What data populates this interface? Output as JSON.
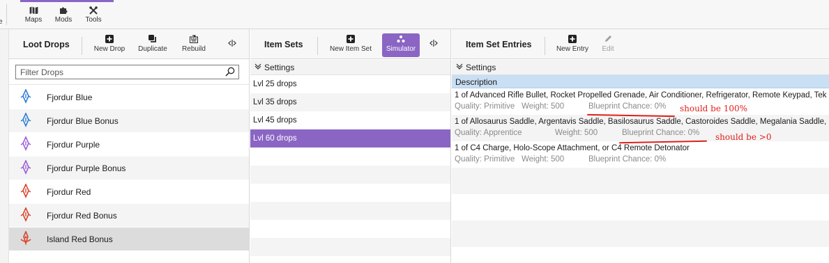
{
  "topbar": {
    "edge_label": "e",
    "buttons": [
      {
        "label": "Maps",
        "icon": "map-icon"
      },
      {
        "label": "Mods",
        "icon": "puzzle-icon"
      },
      {
        "label": "Tools",
        "icon": "tools-icon"
      }
    ]
  },
  "loot_drops": {
    "title": "Loot Drops",
    "buttons": {
      "new_drop": "New Drop",
      "duplicate": "Duplicate",
      "rebuild": "Rebuild"
    },
    "filter_placeholder": "Filter Drops",
    "items": [
      {
        "label": "Fjordur Blue",
        "color": "#2e7fd6"
      },
      {
        "label": "Fjordur Blue Bonus",
        "color": "#2e7fd6"
      },
      {
        "label": "Fjordur Purple",
        "color": "#9b5fd6"
      },
      {
        "label": "Fjordur Purple Bonus",
        "color": "#9b5fd6"
      },
      {
        "label": "Fjordur Red",
        "color": "#d9442e"
      },
      {
        "label": "Fjordur Red Bonus",
        "color": "#d9442e"
      },
      {
        "label": "Island Red Bonus",
        "color": "#d9442e"
      }
    ],
    "selected_index": 6
  },
  "item_sets": {
    "title": "Item Sets",
    "buttons": {
      "new_item_set": "New Item Set",
      "simulator": "Simulator"
    },
    "settings_label": "Settings",
    "items": [
      "Lvl 25 drops",
      "Lvl 35 drops",
      "Lvl 45 drops",
      "Lvl 60 drops"
    ],
    "selected_index": 3
  },
  "entries": {
    "title": "Item Set Entries",
    "buttons": {
      "new_entry": "New Entry",
      "edit": "Edit"
    },
    "settings_label": "Settings",
    "description_header": "Description",
    "rows": [
      {
        "title": "1 of Advanced Rifle Bullet, Rocket Propelled Grenade, Air Conditioner, Refrigerator, Remote Keypad, Tek Light, Tek Generator",
        "quality": "Quality: Primitive",
        "weight": "Weight: 500",
        "blueprint": "Blueprint Chance: 0%"
      },
      {
        "title": "1 of Allosaurus Saddle, Argentavis Saddle, Basilosaurus Saddle, Castoroides Saddle, Megalania Saddle, Mosasaurus Saddle",
        "quality": "Quality: Apprentice",
        "weight": "Weight: 500",
        "blueprint": "Blueprint Chance: 0%"
      },
      {
        "title": "1 of C4 Charge, Holo-Scope Attachment, or C4 Remote Detonator",
        "quality": "Quality: Primitive",
        "weight": "Weight: 500",
        "blueprint": "Blueprint Chance: 0%"
      }
    ]
  },
  "annotations": {
    "note_1": "should be 100%",
    "note_2": "should be >0",
    "color": "#e0201c"
  },
  "colors": {
    "accent": "#8a65c4",
    "description_header": "#c9dff3"
  }
}
